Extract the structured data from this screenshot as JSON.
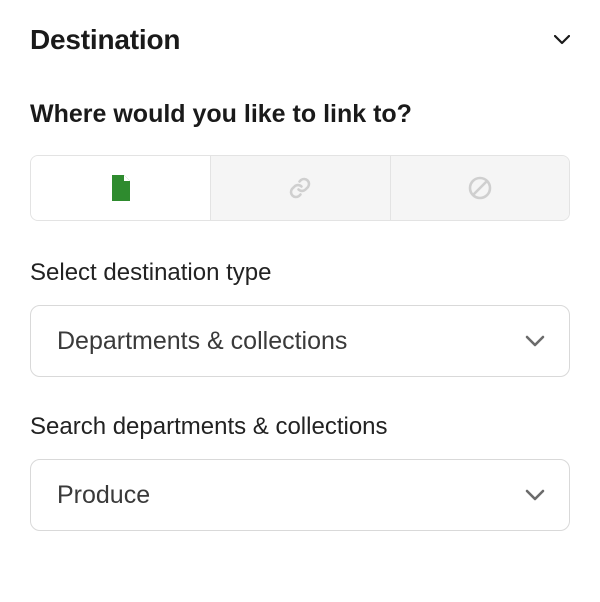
{
  "header": {
    "title": "Destination"
  },
  "question": "Where would you like to link to?",
  "tabs": {
    "page_icon": "page-icon",
    "link_icon": "link-icon",
    "none_icon": "none-icon"
  },
  "type_select": {
    "label": "Select destination type",
    "value": "Departments & collections"
  },
  "search_select": {
    "label": "Search departments & collections",
    "value": "Produce"
  },
  "colors": {
    "accent": "#2e8b2e",
    "muted": "#cfcfcf"
  }
}
